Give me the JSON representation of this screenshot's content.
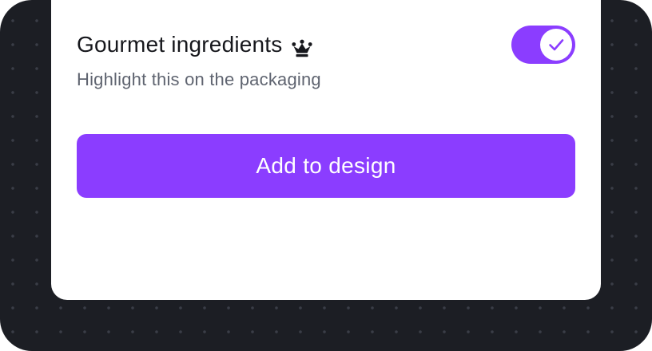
{
  "option": {
    "title": "Gourmet ingredients",
    "subtitle": "Highlight this on the packaging",
    "premium_icon": "crown-icon",
    "toggle": {
      "state": "on",
      "icon": "check-icon"
    }
  },
  "actions": {
    "add_label": "Add to design"
  },
  "colors": {
    "accent": "#8b3dff",
    "backdrop": "#1c1e24",
    "title_text": "#16171c",
    "subtitle_text": "#5f6470",
    "panel": "#ffffff"
  }
}
